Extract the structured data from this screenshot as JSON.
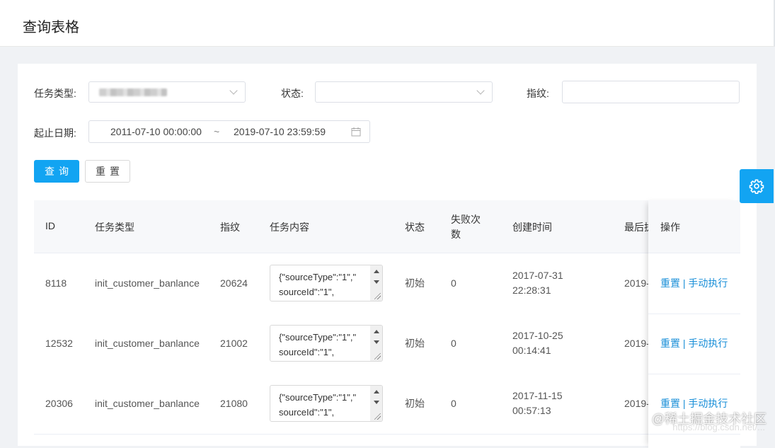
{
  "page": {
    "title": "查询表格"
  },
  "form": {
    "task_type_label": "任务类型:",
    "status_label": "状态:",
    "fingerprint_label": "指纹:",
    "fingerprint_value": "",
    "date_label": "起止日期:",
    "date_start": "2011-07-10 00:00:00",
    "date_separator": "~",
    "date_end": "2019-07-10 23:59:59",
    "query_button": "查询",
    "reset_button": "重置"
  },
  "table": {
    "headers": {
      "id": "ID",
      "task_type": "任务类型",
      "fingerprint": "指纹",
      "content": "任务内容",
      "status": "状态",
      "fail_count": "失败次数",
      "created_at": "创建时间",
      "last_exec": "最后执",
      "actions": "操作"
    },
    "rows": [
      {
        "id": "8118",
        "task_type": "init_customer_banlance",
        "fingerprint": "20624",
        "content": "{\"sourceType\":\"1\",\"\nsourceId\":\"1\",",
        "status": "初始",
        "fail_count": "0",
        "created_date": "2017-07-31",
        "created_time": "22:28:31",
        "last_exec": "2019-"
      },
      {
        "id": "12532",
        "task_type": "init_customer_banlance",
        "fingerprint": "21002",
        "content": "{\"sourceType\":\"1\",\"\nsourceId\":\"1\",",
        "status": "初始",
        "fail_count": "0",
        "created_date": "2017-10-25",
        "created_time": "00:14:41",
        "last_exec": "2019-"
      },
      {
        "id": "20306",
        "task_type": "init_customer_banlance",
        "fingerprint": "21080",
        "content": "{\"sourceType\":\"1\",\"\nsourceId\":\"1\",",
        "status": "初始",
        "fail_count": "0",
        "created_date": "2017-11-15",
        "created_time": "00:57:13",
        "last_exec": "2019-"
      }
    ],
    "action_reset": "重置",
    "action_separator": "|",
    "action_manual": "手动执行"
  },
  "watermark": {
    "text": "@稀土掘金技术社区",
    "url": "https://blog.csdn.net/..."
  },
  "colors": {
    "primary": "#12a4f2",
    "link": "#1a8fd8",
    "background": "#f0f2f5"
  }
}
